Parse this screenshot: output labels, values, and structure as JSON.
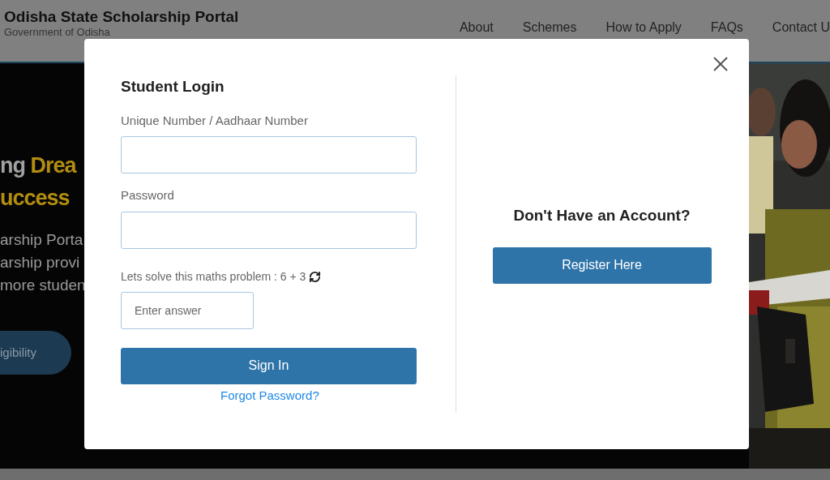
{
  "header": {
    "title": "Odisha State Scholarship Portal",
    "subtitle": "Government of Odisha",
    "nav": [
      "About",
      "Schemes",
      "How to Apply",
      "FAQs",
      "Contact U"
    ]
  },
  "hero": {
    "heading_lines": [
      [
        {
          "kind": "plain",
          "text": "ng "
        },
        {
          "kind": "accent",
          "text": "Drea"
        }
      ],
      [
        {
          "kind": "accent",
          "text": "uccess"
        }
      ]
    ],
    "text_lines": [
      "arship Porta",
      "arship provi",
      "more studen"
    ],
    "button": "igibility",
    "image": {
      "kind": "picture"
    }
  },
  "modal": {
    "title": "Student Login",
    "fields": [
      {
        "label": "Unique Number / Aadhaar Number"
      },
      {
        "label": "Password"
      }
    ],
    "captcha": {
      "prompt": "Lets solve this maths problem : 6 + 3",
      "placeholder": "Enter answer"
    },
    "sign_in": "Sign In",
    "forgot": "Forgot Password?",
    "register_heading": "Don't Have an Account?",
    "register_button": "Register Here"
  }
}
